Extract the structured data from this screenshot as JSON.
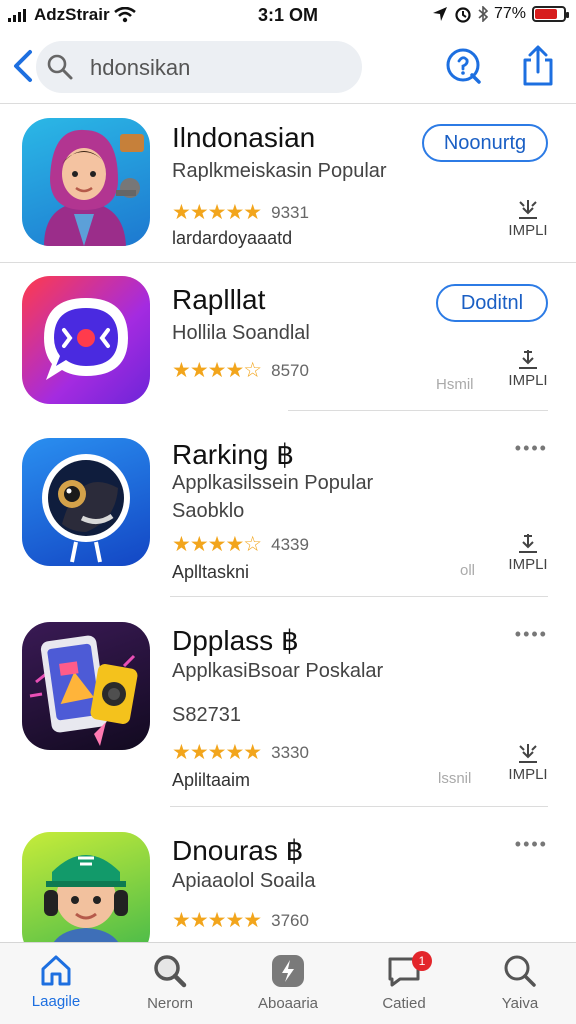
{
  "status_bar": {
    "carrier": "AdzStrair",
    "time": "3:1 OM",
    "battery": "77%",
    "battery_level": 0.77
  },
  "search": {
    "query": "hdonsikan"
  },
  "apps": [
    {
      "name": "Ilndonasian",
      "subtitle": "Raplkmeiskasin Popular",
      "rating_count": "9331",
      "extra": "lardardoyaaatd",
      "button": "Noonurtg",
      "size_label": "IMPLI",
      "rating": 5
    },
    {
      "name": "Raplllat",
      "subtitle": "Hollila Soandlal",
      "rating_count": "8570",
      "side_note": "Hsmil",
      "button": "Doditnl",
      "size_label": "IMPLI",
      "rating": 4.5
    },
    {
      "name": "Rarking ฿",
      "subtitle": "Applkasilssein Popular",
      "extra_top": "Saobklo",
      "rating_count": "4339",
      "extra": "Aplltaskni",
      "side_note": "oll",
      "size_label": "IMPLI",
      "rating": 4.5
    },
    {
      "name": "Dpplass ฿",
      "subtitle": "ApplkasiBsoar Poskalar",
      "extra_top": "S82731",
      "rating_count": "3330",
      "extra": "Apliltaaim",
      "side_note": "lssnil",
      "size_label": "IMPLI",
      "rating": 5
    },
    {
      "name": "Dnouras ฿",
      "subtitle": "Apiaaolol Soaila",
      "rating_count": "3760",
      "rating": 5
    }
  ],
  "tabs": [
    {
      "label": "Laagile",
      "icon": "home-icon"
    },
    {
      "label": "Nerorn",
      "icon": "search-icon"
    },
    {
      "label": "Aboaaria",
      "icon": "apps-icon"
    },
    {
      "label": "Catied",
      "icon": "chat-icon",
      "badge": "1"
    },
    {
      "label": "Yaiva",
      "icon": "search-icon"
    }
  ],
  "colors": {
    "accent": "#1d6fe0",
    "star": "#f2a51c",
    "badge": "#e3262b"
  }
}
